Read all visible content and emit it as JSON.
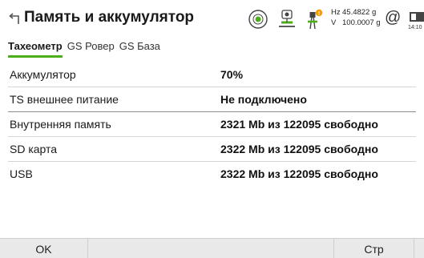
{
  "header": {
    "title": "Память и аккумулятор",
    "back_icon": "back-arrow-icon",
    "status": {
      "hz_label": "Hz",
      "hz_value": "45.4822 g",
      "v_label": "V",
      "v_value": "100.0007 g",
      "at_symbol": "@",
      "time": "14:10"
    }
  },
  "tabs": [
    {
      "label": "Тахеометр",
      "active": true
    },
    {
      "label": "GS Ровер",
      "active": false
    },
    {
      "label": "GS База",
      "active": false
    }
  ],
  "rows": [
    {
      "label": "Аккумулятор",
      "value": "70%"
    },
    {
      "label": "TS внешнее питание",
      "value": "Не подключено"
    },
    {
      "label": "Внутренняя память",
      "value": "2321 Mb из 122095 свободно"
    },
    {
      "label": "SD карта",
      "value": "2322 Mb из 122095 свободно"
    },
    {
      "label": "USB",
      "value": "2322 Mb из 122095 свободно"
    }
  ],
  "footer": {
    "ok_label": "OK",
    "page_label": "Стр"
  },
  "colors": {
    "accent": "#4caf1a",
    "warning": "#f59a00"
  }
}
